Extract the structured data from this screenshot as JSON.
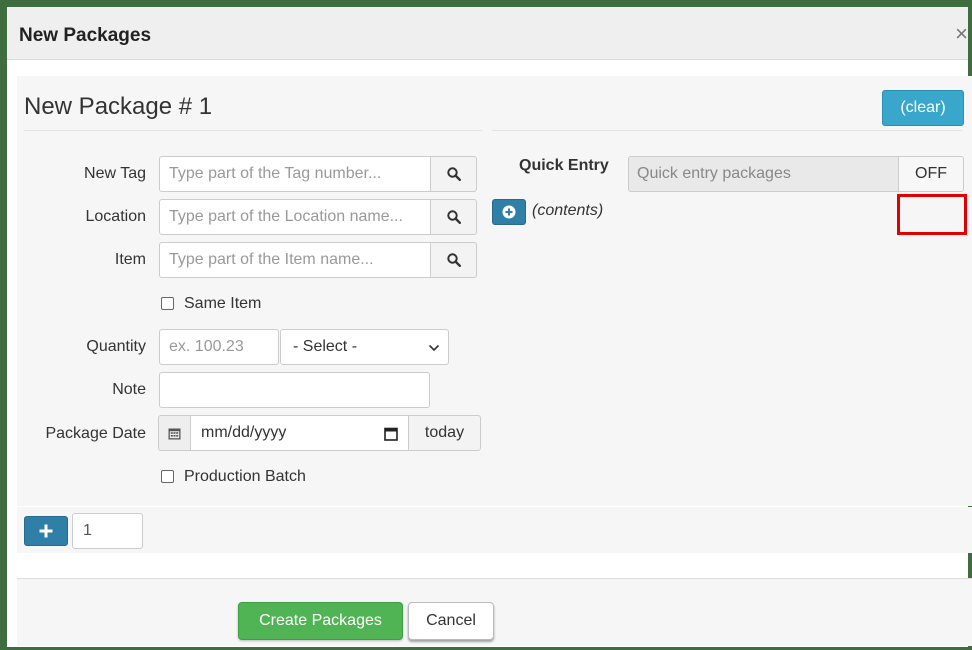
{
  "modal": {
    "title": "New Packages",
    "close_symbol": "×"
  },
  "package": {
    "title": "New Package # 1",
    "clear_label": "(clear)"
  },
  "form": {
    "new_tag": {
      "label": "New Tag",
      "placeholder": "Type part of the Tag number..."
    },
    "location": {
      "label": "Location",
      "placeholder": "Type part of the Location name..."
    },
    "item": {
      "label": "Item",
      "placeholder": "Type part of the Item name..."
    },
    "same_item": {
      "label": "Same Item",
      "checked": false
    },
    "quantity": {
      "label": "Quantity",
      "placeholder": "ex. 100.23",
      "unit_selected": "- Select -"
    },
    "note": {
      "label": "Note",
      "value": ""
    },
    "package_date": {
      "label": "Package Date",
      "placeholder": "mm/dd/yyyy",
      "today_label": "today"
    },
    "production_batch": {
      "label": "Production Batch",
      "checked": false
    }
  },
  "quick_entry": {
    "label": "Quick Entry",
    "placeholder": "Quick entry packages",
    "toggle_label": "OFF"
  },
  "contents": {
    "label": "(contents)"
  },
  "repeat": {
    "count": "1"
  },
  "footer": {
    "create_label": "Create Packages",
    "cancel_label": "Cancel"
  },
  "icons": {
    "search": "search-icon",
    "calendar": "calendar-icon",
    "calendar_picker": "calendar-picker-icon",
    "plus_circle": "plus-circle-icon",
    "plus": "plus-icon",
    "chevron": "chevron-down-icon",
    "close": "close-icon"
  },
  "colors": {
    "frame": "#3f6d3f",
    "info_button": "#39a7cc",
    "primary_button": "#2f7fa6",
    "success_button": "#50b454",
    "highlight_box": "#e00000"
  }
}
